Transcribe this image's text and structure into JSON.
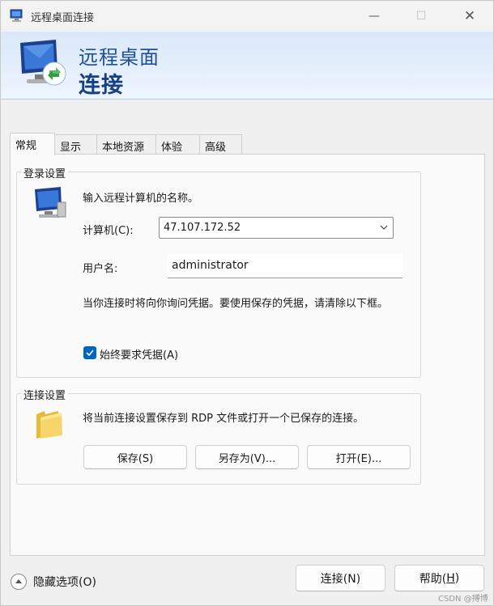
{
  "window": {
    "title": "远程桌面连接"
  },
  "banner": {
    "line1": "远程桌面",
    "line2": "连接"
  },
  "tabs": [
    {
      "label": "常规"
    },
    {
      "label": "显示"
    },
    {
      "label": "本地资源"
    },
    {
      "label": "体验"
    },
    {
      "label": "高级"
    }
  ],
  "login": {
    "legend": "登录设置",
    "prompt": "输入远程计算机的名称。",
    "computer_label": "计算机(C):",
    "computer_value": "47.107.172.52",
    "user_label": "用户名:",
    "user_value": "administrator",
    "note": "当你连接时将向你询问凭据。要使用保存的凭据，请清除以下框。",
    "checkbox_label": "始终要求凭据(A)",
    "checkbox_checked": true
  },
  "connection": {
    "legend": "连接设置",
    "desc": "将当前连接设置保存到 RDP 文件或打开一个已保存的连接。",
    "save": "保存(S)",
    "save_as": "另存为(V)...",
    "open": "打开(E)..."
  },
  "footer": {
    "hide_options": "隐藏选项(O)",
    "connect": "连接(N)",
    "help_text": "帮助(",
    "help_key": "H",
    "help_end": ")"
  },
  "watermark": "CSDN @搏博",
  "colors": {
    "accent": "#0067c0",
    "banner_text": "#1f4f9c"
  }
}
